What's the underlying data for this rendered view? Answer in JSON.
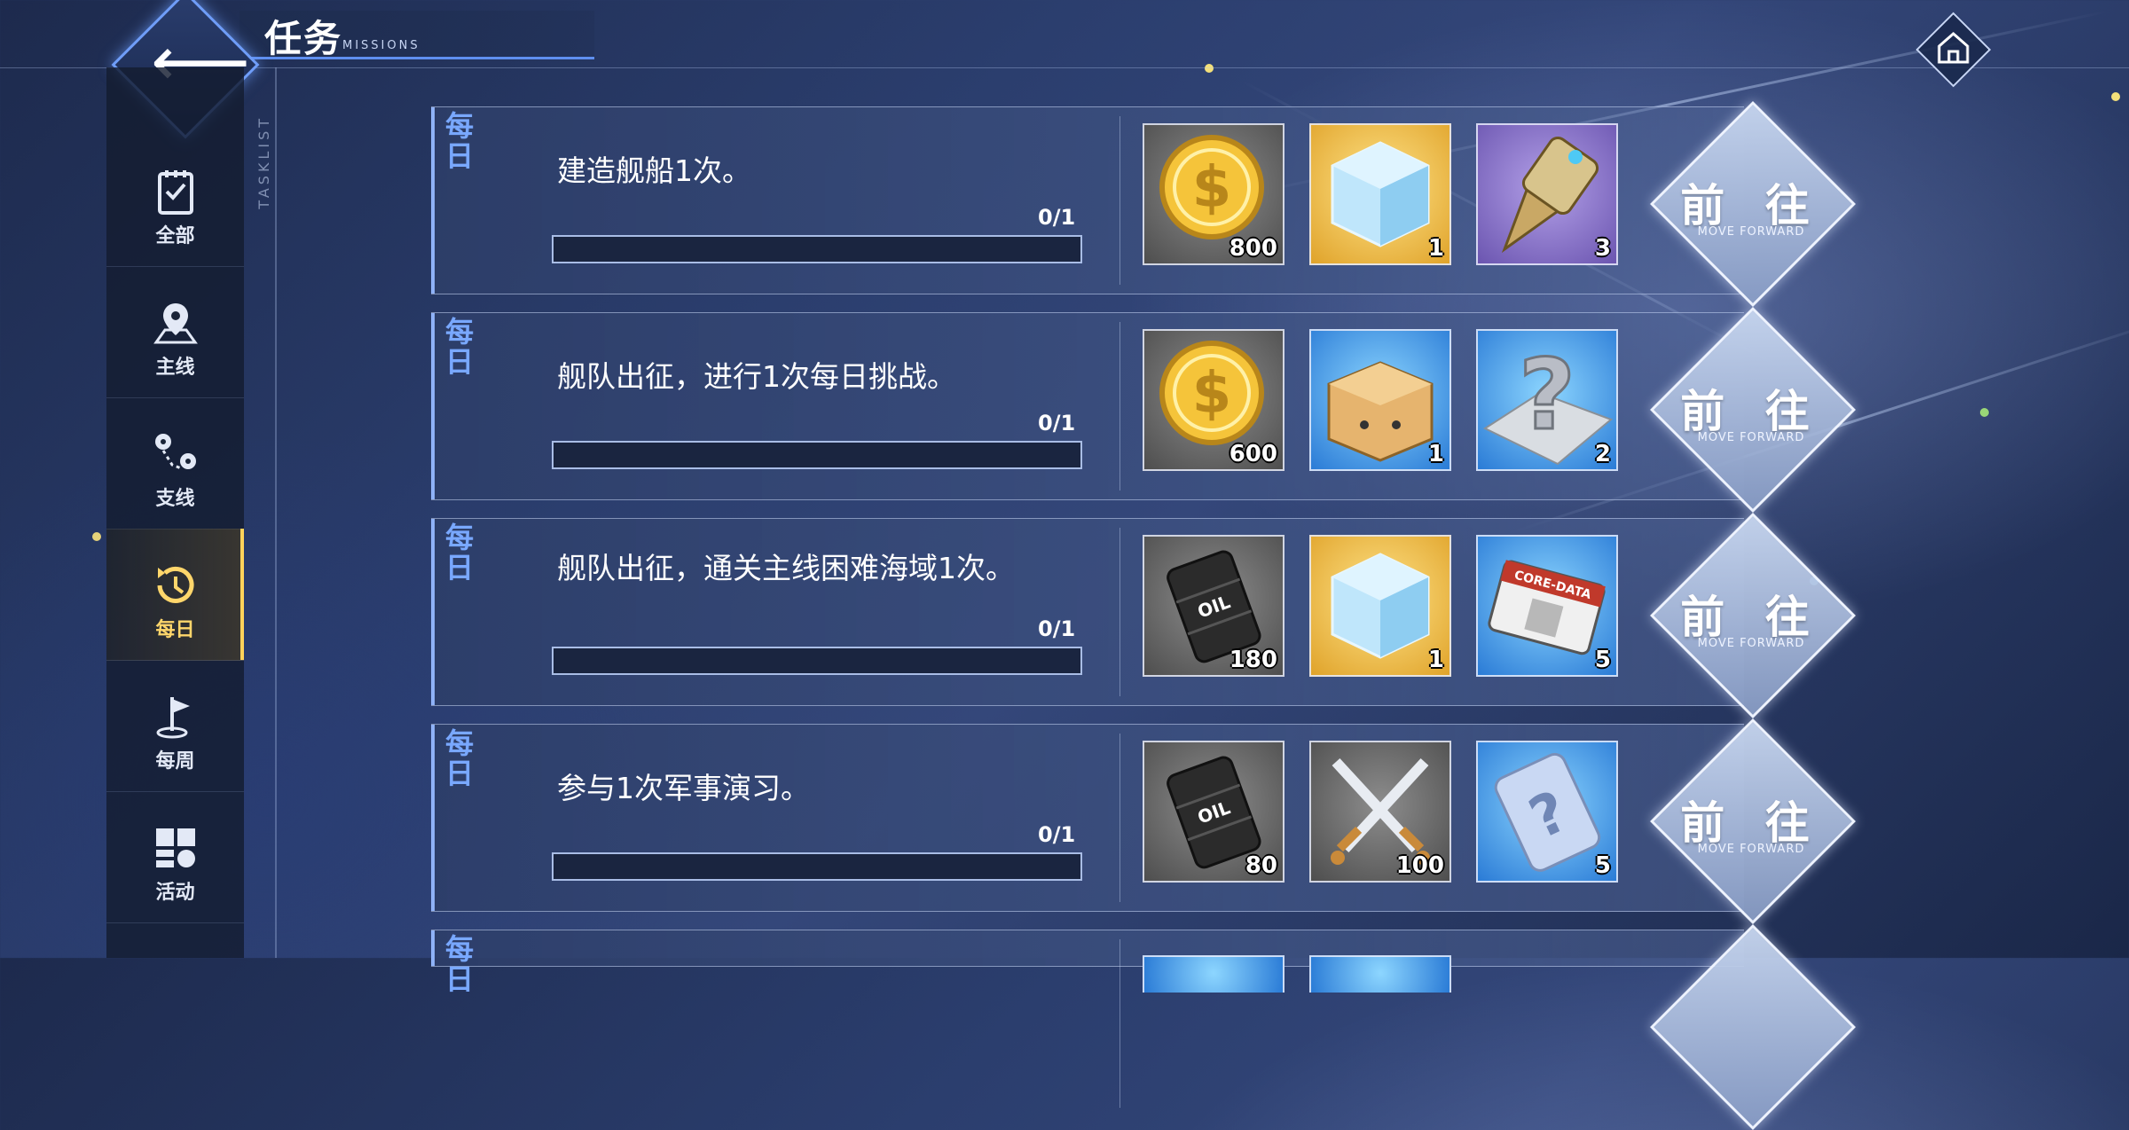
{
  "header": {
    "title": "任务",
    "subtitle": "MISSIONS"
  },
  "sidebar": {
    "tasklist_label": "TASKLIST",
    "items": [
      {
        "label": "全部",
        "icon": "clipboard-icon",
        "active": false
      },
      {
        "label": "主线",
        "icon": "map-pin-icon",
        "active": false
      },
      {
        "label": "支线",
        "icon": "route-icon",
        "active": false
      },
      {
        "label": "每日",
        "icon": "clock-history-icon",
        "active": true
      },
      {
        "label": "每周",
        "icon": "flag-icon",
        "active": false
      },
      {
        "label": "活动",
        "icon": "grid-icon",
        "active": false
      }
    ]
  },
  "tasks": [
    {
      "tag": "每日",
      "desc": "建造舰船1次。",
      "progress_text": "0/1",
      "progress": 0,
      "rewards": [
        {
          "name": "coin",
          "qty": "800"
        },
        {
          "name": "cube",
          "qty": "1"
        },
        {
          "name": "drill",
          "qty": "3"
        }
      ],
      "button": "前 往",
      "button_sub": "MOVE FORWARD"
    },
    {
      "tag": "每日",
      "desc": "舰队出征，进行1次每日挑战。",
      "progress_text": "0/1",
      "progress": 0,
      "rewards": [
        {
          "name": "coin",
          "qty": "600"
        },
        {
          "name": "box",
          "qty": "1"
        },
        {
          "name": "mystery-blueprint",
          "qty": "2"
        }
      ],
      "button": "前 往",
      "button_sub": "MOVE FORWARD"
    },
    {
      "tag": "每日",
      "desc": "舰队出征，通关主线困难海域1次。",
      "progress_text": "0/1",
      "progress": 0,
      "rewards": [
        {
          "name": "oil",
          "qty": "180"
        },
        {
          "name": "cube",
          "qty": "1"
        },
        {
          "name": "core-data",
          "qty": "5"
        }
      ],
      "button": "前 往",
      "button_sub": "MOVE FORWARD"
    },
    {
      "tag": "每日",
      "desc": "参与1次军事演习。",
      "progress_text": "0/1",
      "progress": 0,
      "rewards": [
        {
          "name": "oil",
          "qty": "80"
        },
        {
          "name": "swords",
          "qty": "100"
        },
        {
          "name": "mystery-card",
          "qty": "5"
        }
      ],
      "button": "前 往",
      "button_sub": "MOVE FORWARD"
    },
    {
      "tag": "每日",
      "desc": "",
      "progress_text": "",
      "progress": 0,
      "rewards": [
        {
          "name": "",
          "qty": ""
        },
        {
          "name": "",
          "qty": ""
        }
      ],
      "button": "",
      "button_sub": ""
    }
  ]
}
